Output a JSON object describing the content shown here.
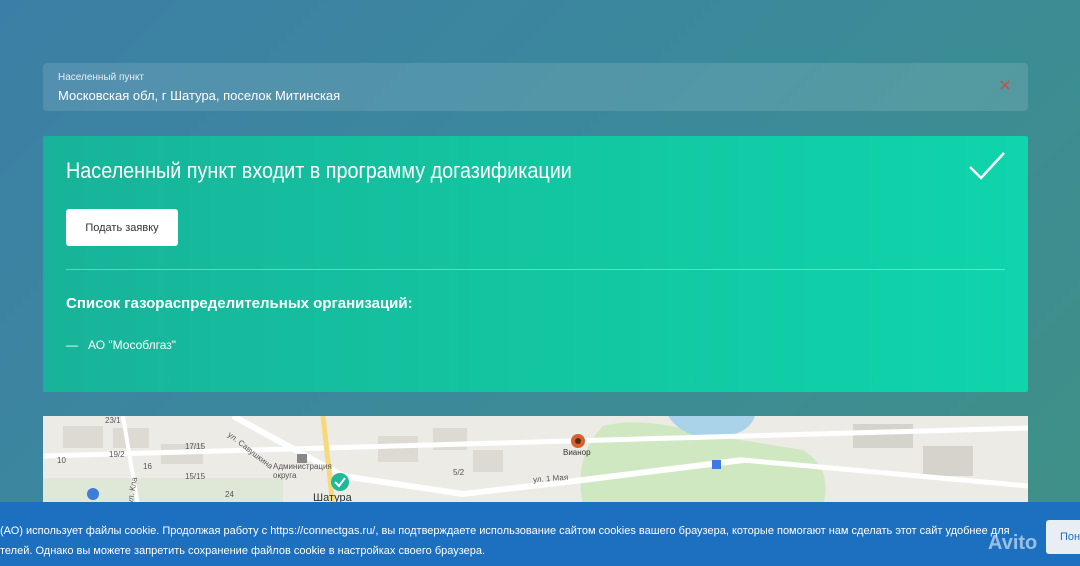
{
  "location": {
    "label": "Населенный пункт",
    "value": "Московская обл, г Шатура, поселок Митинская",
    "clear_icon": "close-icon"
  },
  "result": {
    "title": "Населенный пункт входит в программу догазификации",
    "status_icon": "checkmark-icon",
    "apply_button": "Подать заявку",
    "orgs_heading": "Список газораспределительных организаций:",
    "orgs": [
      {
        "dash": "—",
        "name": "АО \"Мособлгаз\""
      }
    ]
  },
  "map": {
    "labels": {
      "street_savushkina": "ул. Савушкина",
      "admin": "Администрация округа",
      "city": "Шатура",
      "vianor": "Вианор",
      "street_1maya": "ул. 1 Мая",
      "street_kl": "ул. Кла",
      "n_23_1": "23/1",
      "n_17_15": "17/15",
      "n_19_2": "19/2",
      "n_16": "16",
      "n_15_15": "15/15",
      "n_24": "24",
      "n_5_2": "5/2",
      "n_10": "10"
    },
    "colors": {
      "land": "#ecebe6",
      "water": "#aad3ea",
      "green": "#cfe8c2",
      "road": "#ffffff",
      "marker": "#1fb89a"
    }
  },
  "cookie": {
    "line1": "(АО) использует файлы cookie. Продолжая работу с https://connectgas.ru/, вы подтверждаете использование сайтом cookies вашего браузера, которые помогают нам сделать этот сайт удобнее для",
    "line2": "телей. Однако вы можете запретить сохранение файлов cookie в настройках своего браузера.",
    "button": "Пон"
  },
  "watermark": "Avito",
  "colors": {
    "card_start": "#18b39a",
    "card_end": "#0fd4ac",
    "cookie_bar": "#1d6fc0",
    "clear": "#c0524f"
  }
}
